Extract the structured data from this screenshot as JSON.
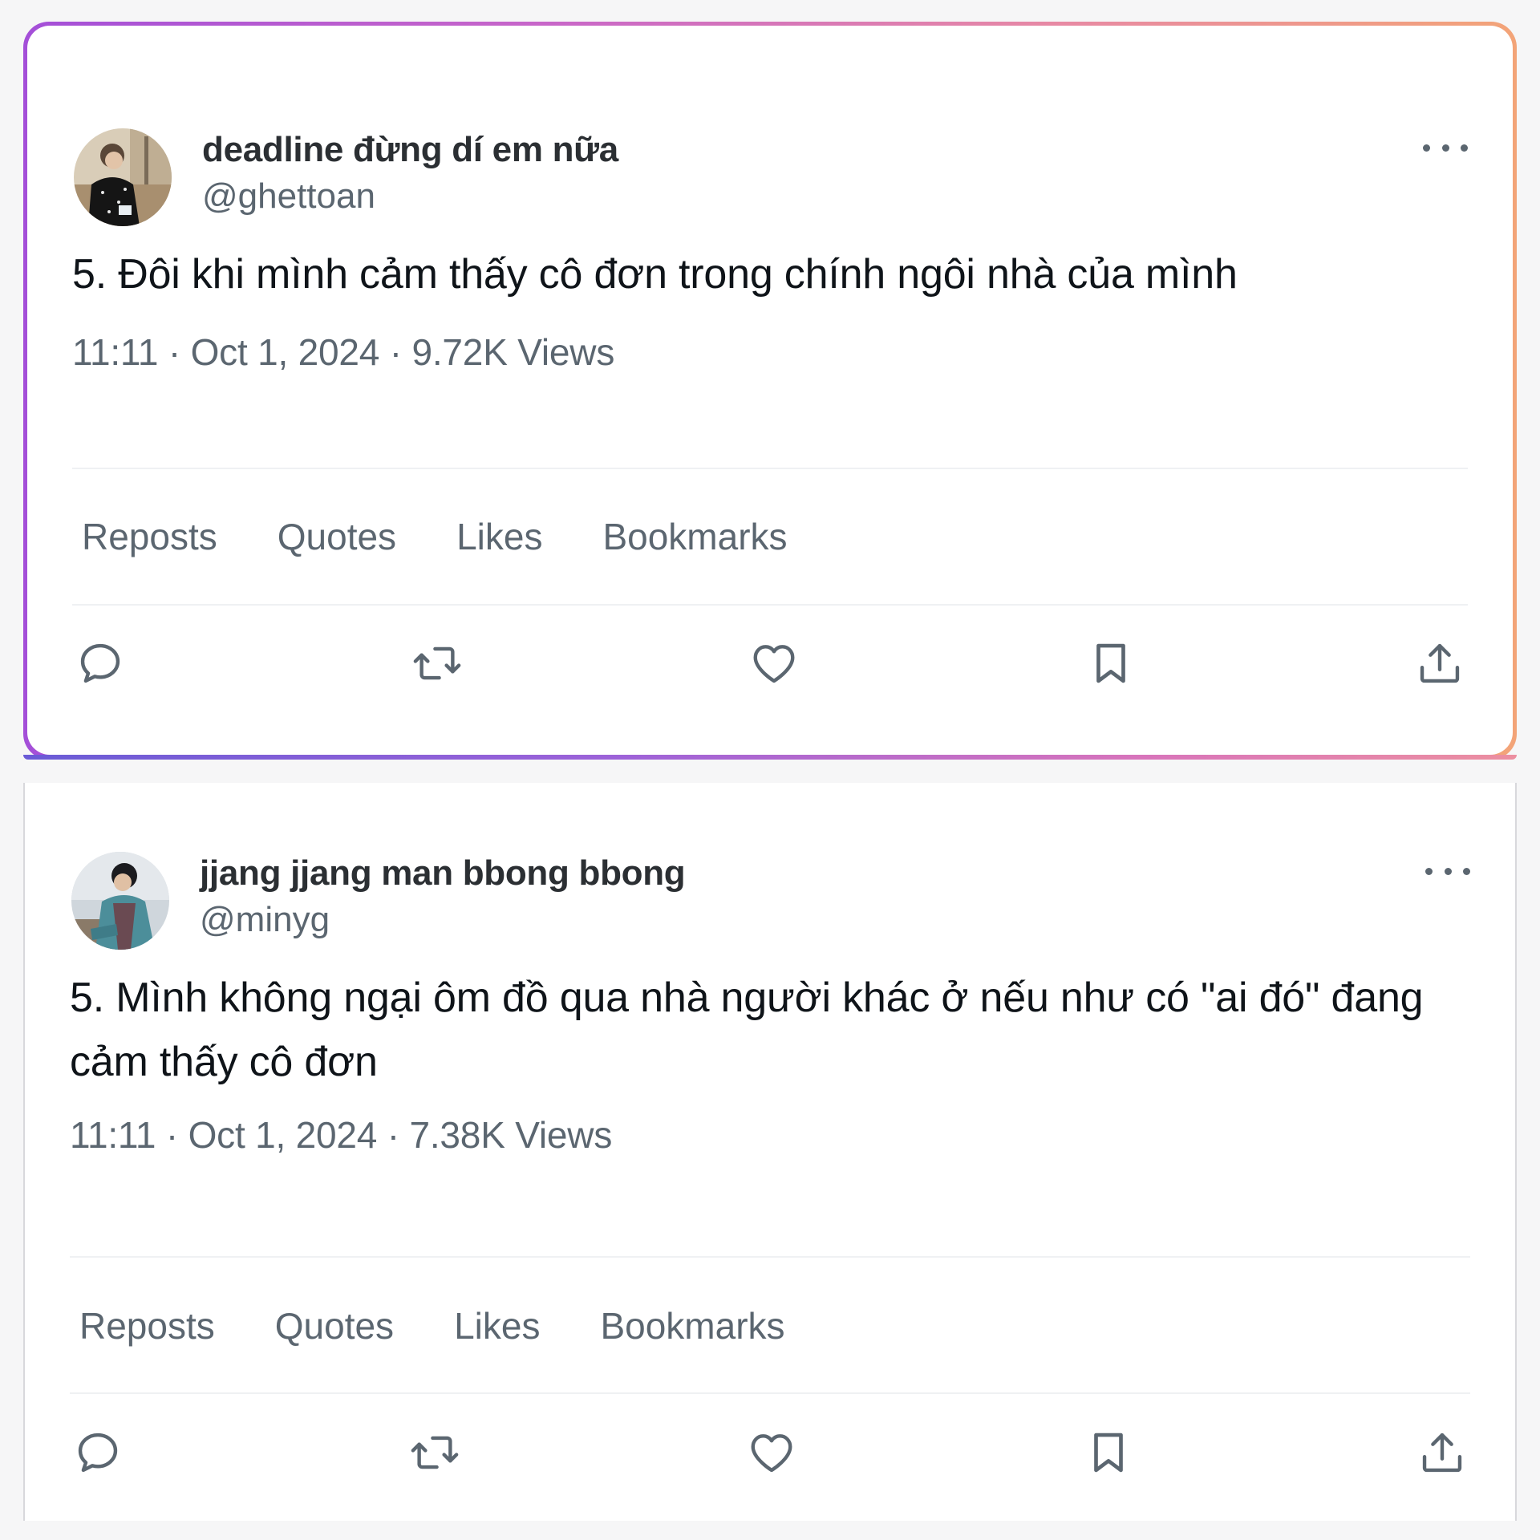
{
  "tweets": [
    {
      "display_name": "deadline đừng dí em nữa",
      "handle": "@ghettoan",
      "text": "5. Đôi khi mình cảm thấy cô đơn trong chính ngôi nhà của mình",
      "time": "11:11",
      "date": "Oct 1, 2024",
      "views": "9.72K Views",
      "meta_line": "11:11 · Oct 1, 2024 · 9.72K Views",
      "stats": [
        "Reposts",
        "Quotes",
        "Likes",
        "Bookmarks"
      ]
    },
    {
      "display_name": "jjang jjang man bbong bbong",
      "handle": "@minyg",
      "text": "5. Mình không ngại ôm đồ qua nhà người khác ở nếu như có \"ai đó\" đang cảm thấy cô đơn",
      "time": "11:11",
      "date": "Oct 1, 2024",
      "views": "7.38K Views",
      "meta_line": "11:11 · Oct 1, 2024 · 7.38K Views",
      "stats": [
        "Reposts",
        "Quotes",
        "Likes",
        "Bookmarks"
      ]
    }
  ],
  "icons": {
    "more": "more-horizontal-icon",
    "reply": "reply-icon",
    "repost": "repost-icon",
    "like": "heart-icon",
    "bookmark": "bookmark-icon",
    "share": "share-icon"
  },
  "colors": {
    "text_primary": "#0f1419",
    "text_secondary": "#5b6670",
    "gradient_start": "#a44fd8",
    "gradient_end": "#f3a478"
  }
}
